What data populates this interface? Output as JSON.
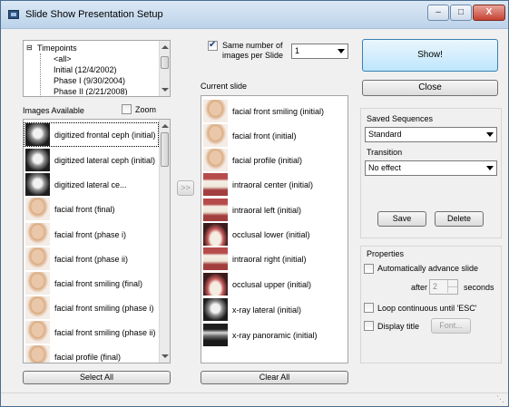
{
  "window": {
    "title": "Slide Show Presentation Setup",
    "minimize": "–",
    "maximize": "□",
    "close": "X"
  },
  "timepoints": {
    "root": "Timepoints",
    "items": [
      "<all>",
      "Initial (12/4/2002)",
      "Phase I (9/30/2004)",
      "Phase II (2/21/2008)"
    ]
  },
  "images_available": {
    "label": "Images Available",
    "zoom_label": "Zoom",
    "zoom_checked": false,
    "items": [
      {
        "label": "digitized frontal ceph (initial)",
        "icon": "xray-icon"
      },
      {
        "label": "digitized lateral ceph (initial)",
        "icon": "xray-icon"
      },
      {
        "label": "digitized lateral ce...",
        "icon": "xray-icon"
      },
      {
        "label": "facial front (final)",
        "icon": "face-icon"
      },
      {
        "label": "facial front (phase i)",
        "icon": "face-icon"
      },
      {
        "label": "facial front (phase ii)",
        "icon": "face-icon"
      },
      {
        "label": "facial front smiling (final)",
        "icon": "face-icon"
      },
      {
        "label": "facial front smiling (phase i)",
        "icon": "face-icon"
      },
      {
        "label": "facial front smiling (phase ii)",
        "icon": "face-icon"
      },
      {
        "label": "facial profile (final)",
        "icon": "face-icon"
      }
    ],
    "select_all": "Select All"
  },
  "transfer_button": ">>",
  "same_number": {
    "label_line1": "Same number of",
    "label_line2": "images per Slide",
    "checked": true,
    "value": "1"
  },
  "current_slide": {
    "label": "Current slide",
    "items": [
      {
        "label": "facial front smiling (initial)",
        "icon": "face-icon"
      },
      {
        "label": "facial front (initial)",
        "icon": "face-icon"
      },
      {
        "label": "facial profile (initial)",
        "icon": "face-icon"
      },
      {
        "label": "intraoral center (initial)",
        "icon": "teeth-icon"
      },
      {
        "label": "intraoral left (initial)",
        "icon": "teeth-icon"
      },
      {
        "label": "occlusal lower (initial)",
        "icon": "arch-icon"
      },
      {
        "label": "intraoral right (initial)",
        "icon": "teeth-icon"
      },
      {
        "label": "occlusal upper (initial)",
        "icon": "arch-icon"
      },
      {
        "label": "x-ray lateral (initial)",
        "icon": "xray-icon"
      },
      {
        "label": "x-ray panoramic (initial)",
        "icon": "xray-pano-icon"
      }
    ],
    "clear_all": "Clear All"
  },
  "actions": {
    "show": "Show!",
    "close": "Close"
  },
  "saved_sequences": {
    "label": "Saved Sequences",
    "value": "Standard",
    "transition_label": "Transition",
    "transition_value": "No effect",
    "save": "Save",
    "delete": "Delete"
  },
  "properties": {
    "label": "Properties",
    "auto_advance": "Automatically advance slide",
    "after": "after",
    "seconds_value": "2",
    "seconds": "seconds",
    "loop": "Loop continuous until 'ESC'",
    "display_title": "Display title",
    "font": "Font..."
  }
}
